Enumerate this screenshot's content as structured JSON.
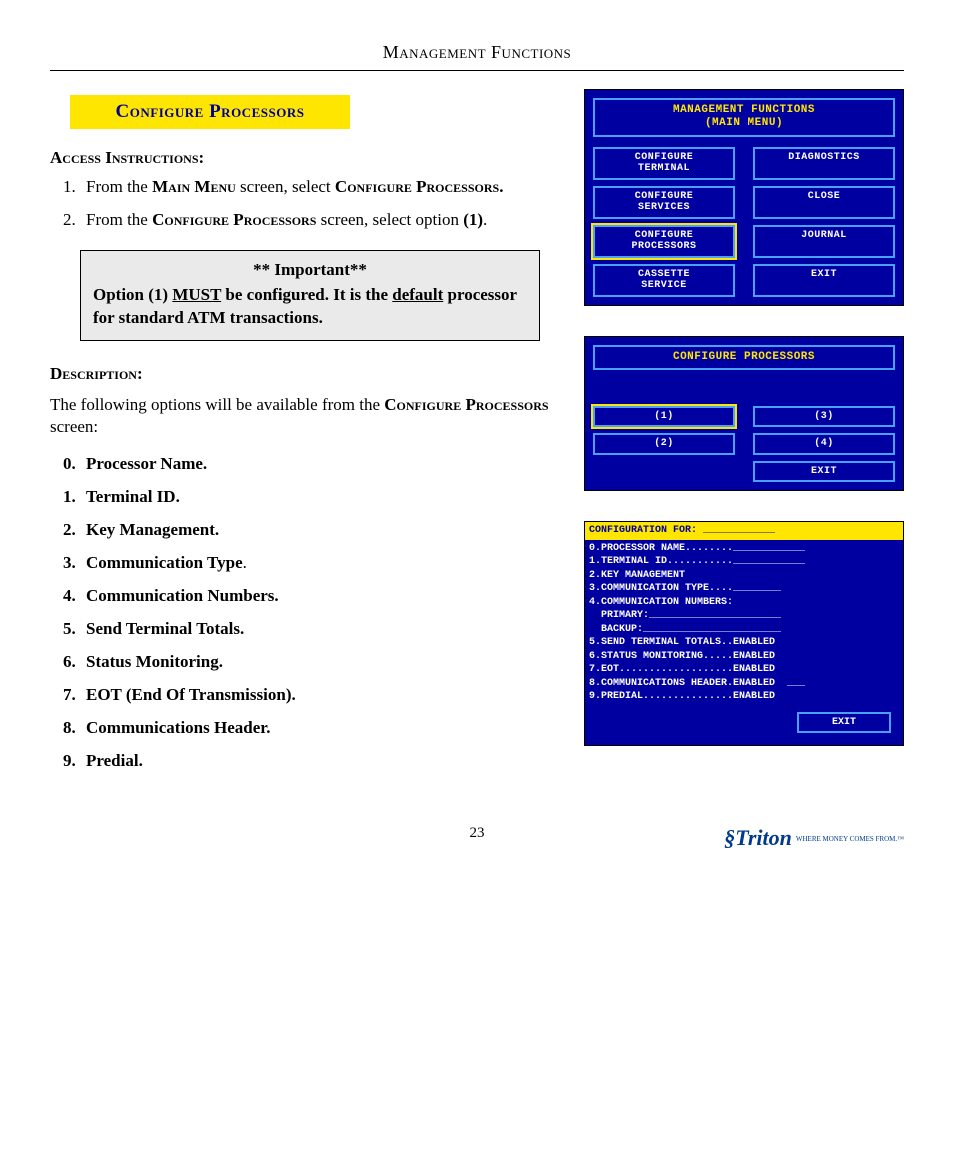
{
  "pageHeader": "Management Functions",
  "sectionTitle": "Configure  Processors",
  "accessLabel": "Access Instructions:",
  "instr1_a": "From the ",
  "instr1_b": "Main Menu",
  "instr1_c": " screen, select ",
  "instr1_d": "Configure Processors.",
  "instr2_a": "From the ",
  "instr2_b": "Configure Processors",
  "instr2_c": " screen, select option ",
  "instr2_d": "(1)",
  "instr2_e": ".",
  "importantHdr": "** Important**",
  "importantBody_a": "Option (1) ",
  "importantBody_b": "MUST",
  "importantBody_c": " be configured. It is the ",
  "importantBody_d": "default",
  "importantBody_e": " processor for standard ATM transactions.",
  "descLabel": "Description:",
  "descIntro_a": "The following options will be available from the ",
  "descIntro_b": "Configure Processors",
  "descIntro_c": "  screen:",
  "opts": {
    "o0": "Processor Name.",
    "o1": "Terminal ID.",
    "o2": "Key Management.",
    "o3": "Communication Type",
    "o4": "Communication Numbers.",
    "o5": "Send Terminal Totals.",
    "o6": "Status Monitoring.",
    "o7": "EOT (End Of Transmission).",
    "o8": "Communications Header.",
    "o9": "Predial."
  },
  "atm1": {
    "title1": "MANAGEMENT FUNCTIONS",
    "title2": "(MAIN MENU)",
    "b1": "CONFIGURE\nTERMINAL",
    "b2": "DIAGNOSTICS",
    "b3": "CONFIGURE\nSERVICES",
    "b4": "CLOSE",
    "b5": "CONFIGURE\nPROCESSORS",
    "b6": "JOURNAL",
    "b7": "CASSETTE\nSERVICE",
    "b8": "EXIT"
  },
  "atm2": {
    "title": "CONFIGURE PROCESSORS",
    "b1": "(1)",
    "b2": "(3)",
    "b3": "(2)",
    "b4": "(4)",
    "exit": "EXIT"
  },
  "cfg": {
    "title": "CONFIGURATION FOR: ____________",
    "l0": "0.PROCESSOR NAME........____________",
    "l1": "1.TERMINAL ID...........____________",
    "l2": "2.KEY MANAGEMENT",
    "l3": "3.COMMUNICATION TYPE....________",
    "l4": "4.COMMUNICATION NUMBERS:",
    "l4a": "  PRIMARY:______________________",
    "l4b": "  BACKUP:_______________________",
    "l5": "5.SEND TERMINAL TOTALS..ENABLED",
    "l6": "6.STATUS MONITORING.....ENABLED",
    "l7": "7.EOT...................ENABLED",
    "l8": "8.COMMUNICATIONS HEADER.ENABLED  ___",
    "l9": "9.PREDIAL...............ENABLED",
    "exit": "EXIT"
  },
  "pageNumber": "23",
  "brandName": "Triton",
  "brandTag": "WHERE MONEY COMES FROM.™"
}
